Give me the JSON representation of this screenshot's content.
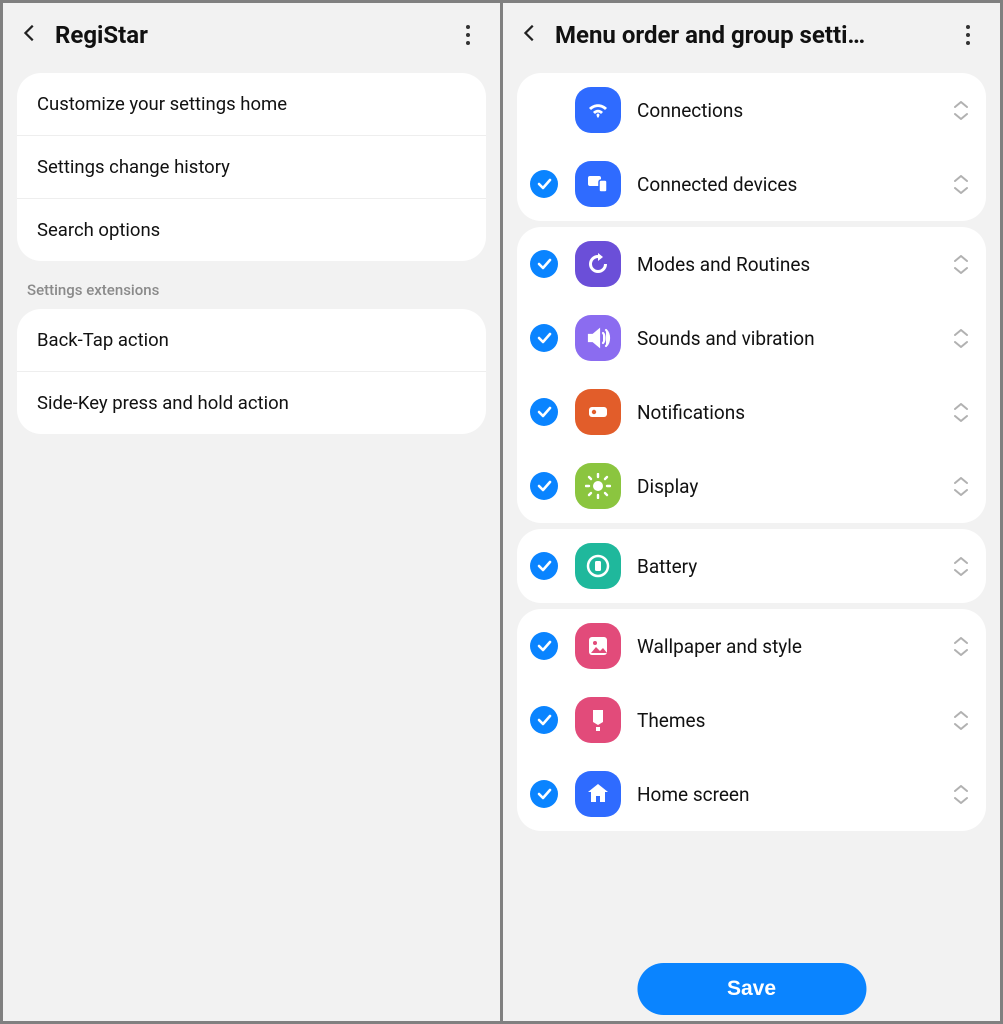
{
  "left": {
    "title": "RegiStar",
    "items_main": [
      "Customize your settings home",
      "Settings change history",
      "Search options"
    ],
    "section_label": "Settings extensions",
    "items_ext": [
      "Back-Tap action",
      "Side-Key press and hold action"
    ]
  },
  "right": {
    "title": "Menu order and group setti…",
    "save_label": "Save",
    "groups": [
      [
        {
          "label": "Connections",
          "checked": false,
          "color": "#2f6bff",
          "icon": "wifi"
        },
        {
          "label": "Connected devices",
          "checked": true,
          "color": "#2f6bff",
          "icon": "devices"
        }
      ],
      [
        {
          "label": "Modes and Routines",
          "checked": true,
          "color": "#6b4fd8",
          "icon": "refresh"
        },
        {
          "label": "Sounds and vibration",
          "checked": true,
          "color": "#8b6cf0",
          "icon": "sound"
        },
        {
          "label": "Notifications",
          "checked": true,
          "color": "#e25d2a",
          "icon": "notif"
        },
        {
          "label": "Display",
          "checked": true,
          "color": "#8bc53f",
          "icon": "sun"
        }
      ],
      [
        {
          "label": "Battery",
          "checked": true,
          "color": "#1fb89c",
          "icon": "battery"
        }
      ],
      [
        {
          "label": "Wallpaper and style",
          "checked": true,
          "color": "#e24b7a",
          "icon": "image"
        },
        {
          "label": "Themes",
          "checked": true,
          "color": "#e24b7a",
          "icon": "brush"
        },
        {
          "label": "Home screen",
          "checked": true,
          "color": "#2f6bff",
          "icon": "home"
        }
      ]
    ]
  }
}
